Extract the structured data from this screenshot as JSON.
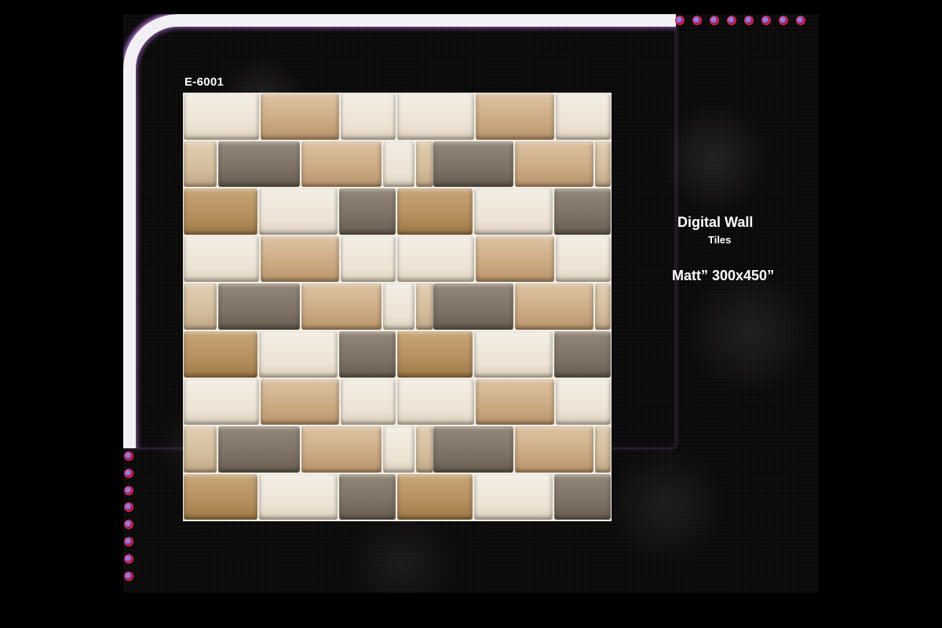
{
  "catalog": {
    "code": "E-6001",
    "title": "Digital Wall",
    "subtitle": "Tiles",
    "finish_size": "Matt” 300x450”"
  },
  "colors": {
    "background": "#000000",
    "panel": "#0b0a0b",
    "frame": "#f2f0f4",
    "frame_glow": "#be78e6",
    "bead": "#c0123b",
    "text": "#ffffff"
  },
  "tile_palette": [
    "cream",
    "beige",
    "tan",
    "grey",
    "sand"
  ]
}
